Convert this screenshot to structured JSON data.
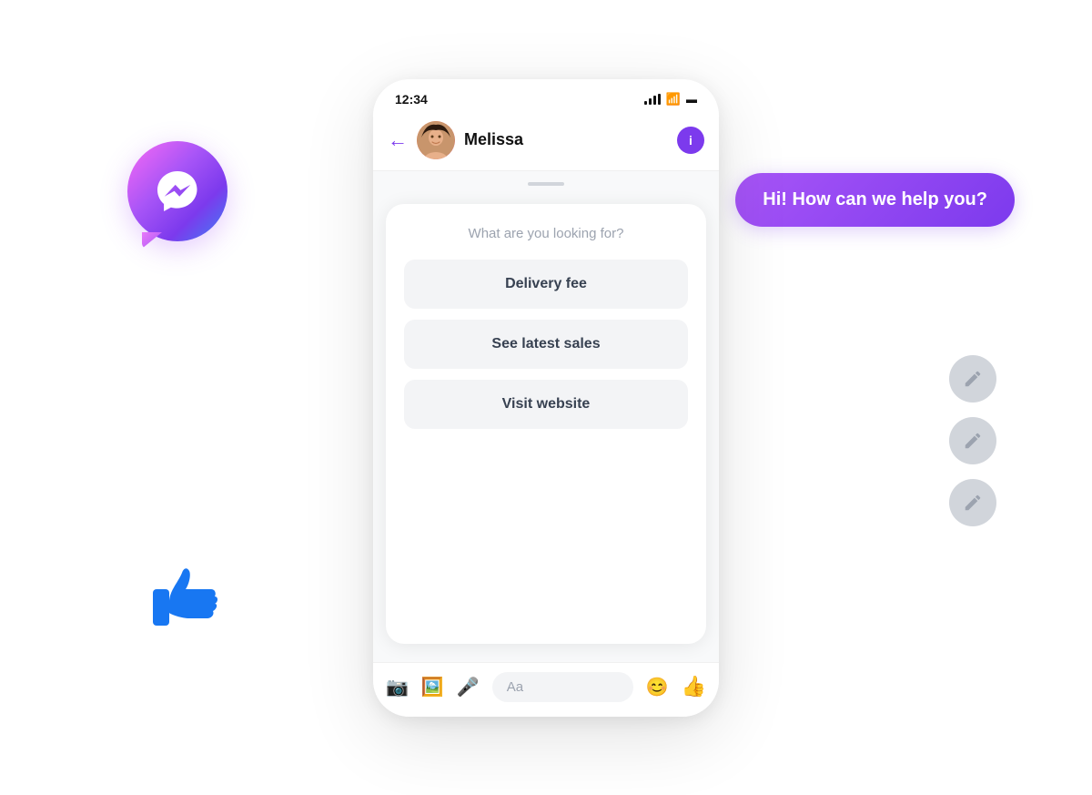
{
  "messenger": {
    "icon_label": "Messenger"
  },
  "hi_bubble": {
    "text": "Hi! How can we help you?"
  },
  "phone": {
    "status_bar": {
      "time": "12:34",
      "signal": "signal",
      "wifi": "wifi",
      "battery": "battery"
    },
    "header": {
      "contact_name": "Melissa",
      "back_label": "←",
      "info_label": "i"
    },
    "chat": {
      "question": "What are you looking for?",
      "buttons": [
        {
          "label": "Delivery fee"
        },
        {
          "label": "See latest sales"
        },
        {
          "label": "Visit website"
        }
      ]
    },
    "input_bar": {
      "placeholder": "Aa"
    }
  },
  "edit_buttons": [
    {
      "label": "edit"
    },
    {
      "label": "edit"
    },
    {
      "label": "edit"
    }
  ],
  "thumbs_up": {
    "label": "👍"
  }
}
